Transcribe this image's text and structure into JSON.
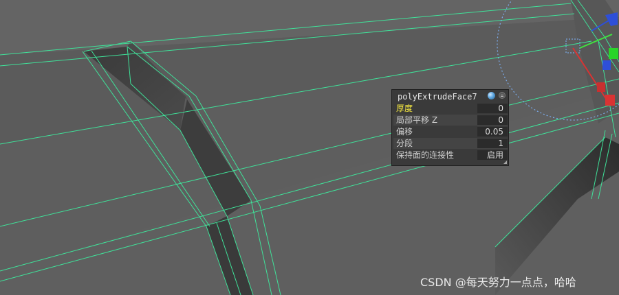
{
  "hud": {
    "title": "polyExtrudeFace7",
    "rows": [
      {
        "label": "厚度",
        "value": "0",
        "active": true
      },
      {
        "label": "局部平移 Z",
        "value": "0",
        "active": false
      },
      {
        "label": "偏移",
        "value": "0.05",
        "active": false
      },
      {
        "label": "分段",
        "value": "1",
        "active": false
      },
      {
        "label": "保持面的连接性",
        "value": "启用",
        "active": false
      }
    ]
  },
  "watermark": "CSDN @每天努力一点点，哈哈",
  "colors": {
    "viewport_bg": "#5f5f5f",
    "wireframe": "#3fe39a",
    "active_label": "#f3e641",
    "manipulator_ring": "#7fb6ff"
  },
  "icons": [
    "move-manipulator-icon",
    "hud-status-icon",
    "hud-menu-icon"
  ]
}
